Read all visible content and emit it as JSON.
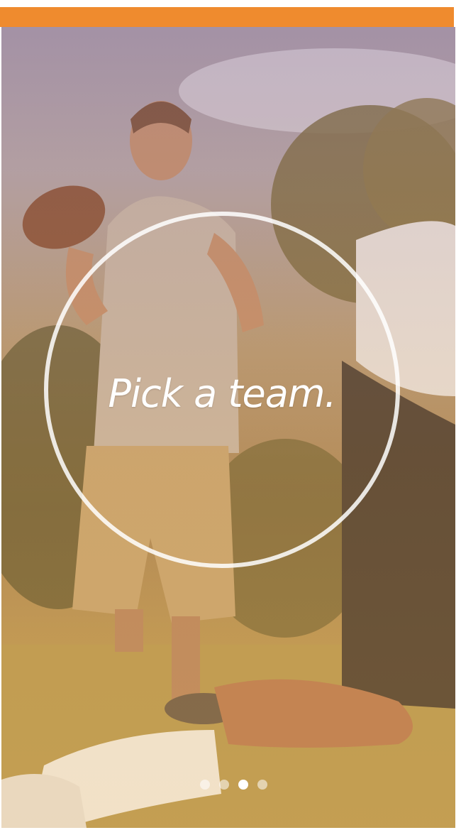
{
  "header": {
    "bar_color": "#ef8b2e"
  },
  "hero": {
    "image": "football-players-background",
    "headline": "Pick a team."
  },
  "pager": {
    "count": 4,
    "active_index": 2
  }
}
